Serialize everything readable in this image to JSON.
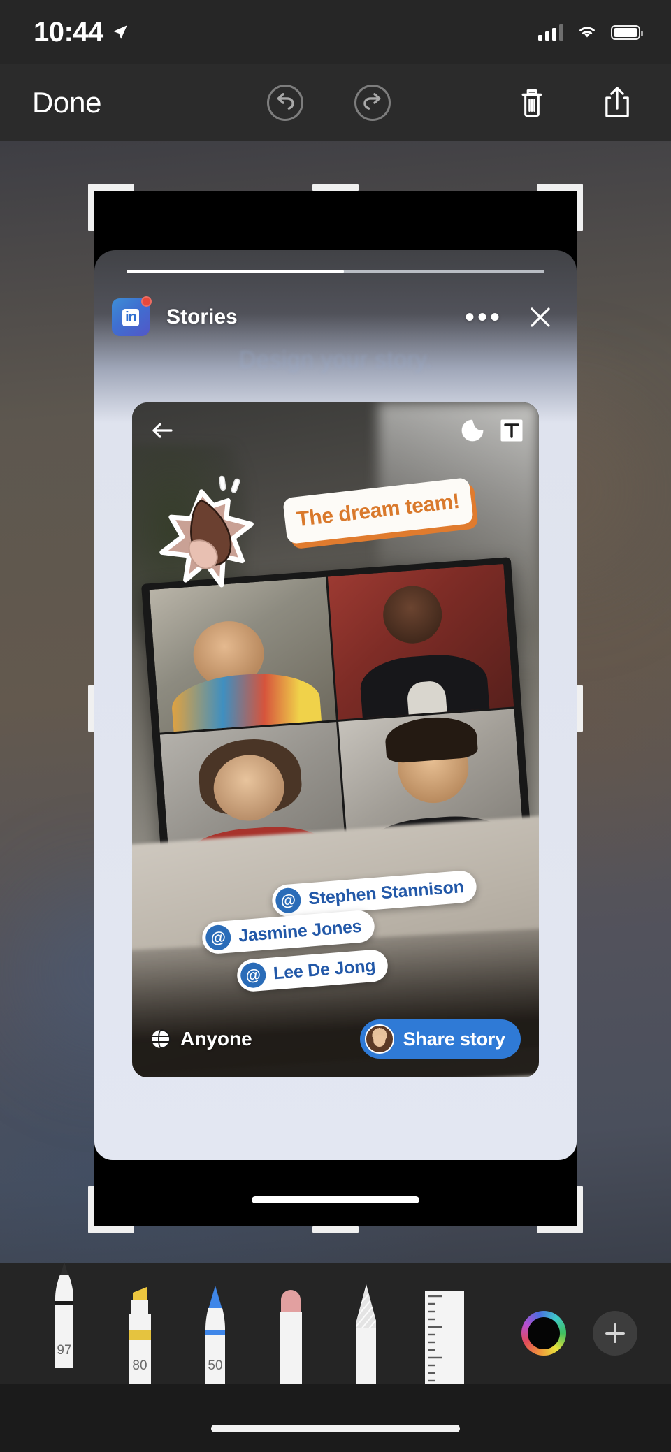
{
  "status_bar": {
    "time": "10:44",
    "location_icon": "location-arrow-icon",
    "signal_icon": "cellular-signal-icon",
    "wifi_icon": "wifi-icon",
    "battery_icon": "battery-full-icon"
  },
  "toolbar": {
    "done_label": "Done",
    "undo_icon": "undo-icon",
    "redo_icon": "redo-icon",
    "trash_icon": "trash-icon",
    "share_icon": "share-icon"
  },
  "crop": {
    "handles": [
      "top-left",
      "top-center",
      "top-right",
      "middle-left",
      "middle-right",
      "bottom-left",
      "bottom-center",
      "bottom-right"
    ]
  },
  "screenshot": {
    "app": {
      "badge_text": "in",
      "badge_notification": true,
      "title": "Stories",
      "more_icon": "ellipsis-icon",
      "close_icon": "close-icon",
      "subtitle": "Design your story.",
      "progress_percent": 52
    },
    "story": {
      "back_icon": "back-arrow-icon",
      "sticker_icon": "sticker-icon",
      "text_icon": "text-tool-icon",
      "banner_text": "The dream team!",
      "banner_color": "#d9792c",
      "clap_sticker": "clapping-hands-sticker",
      "mentions": [
        {
          "handle": "@",
          "name": "Stephen Stannison"
        },
        {
          "handle": "@",
          "name": "Jasmine Jones"
        },
        {
          "handle": "@",
          "name": "Lee De Jong"
        }
      ],
      "audience_icon": "globe-icon",
      "audience_label": "Anyone",
      "share_label": "Share story",
      "share_avatar": "user-avatar",
      "accent_blue": "#2f7ad6"
    }
  },
  "markup_tools": [
    {
      "name": "pen",
      "value": "97",
      "color": "#1a1a1a",
      "selected": true
    },
    {
      "name": "highlighter",
      "value": "80",
      "color": "#e8c63f",
      "selected": false
    },
    {
      "name": "pencil",
      "value": "50",
      "color": "#3f86e8",
      "selected": false
    },
    {
      "name": "eraser",
      "value": "",
      "color": "#e2a0a0",
      "selected": false
    },
    {
      "name": "smudge",
      "value": "",
      "color": "#d8d8d8",
      "selected": false
    },
    {
      "name": "ruler",
      "value": "",
      "color": "#f0f0f0",
      "selected": false
    }
  ],
  "color_picker": {
    "selected_color": "#050505",
    "wheel_icon": "color-wheel-icon",
    "add_icon": "plus-icon"
  },
  "home_indicator": "home-indicator"
}
